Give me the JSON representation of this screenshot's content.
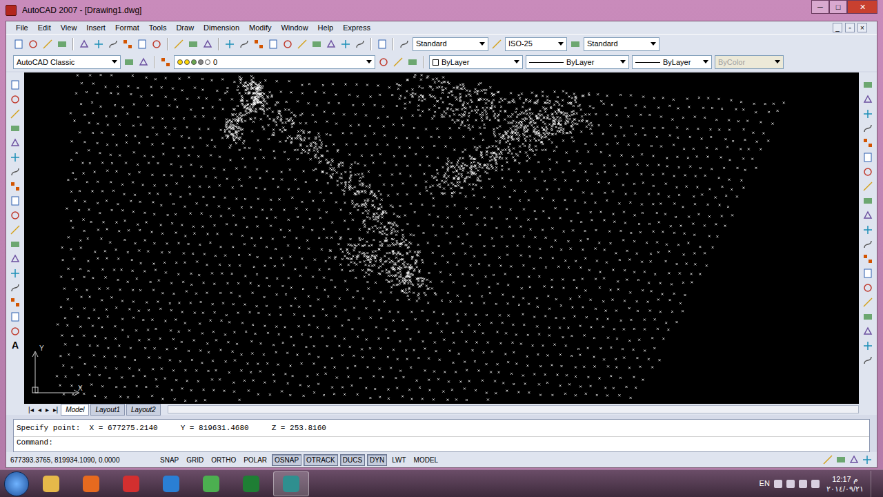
{
  "window": {
    "title": "AutoCAD 2007 - [Drawing1.dwg]",
    "controls": [
      "─",
      "□",
      "✕"
    ],
    "document_controls": [
      "_",
      "▫",
      "×"
    ]
  },
  "menu": [
    "File",
    "Edit",
    "View",
    "Insert",
    "Format",
    "Tools",
    "Draw",
    "Dimension",
    "Modify",
    "Window",
    "Help",
    "Express"
  ],
  "toolbar": {
    "text_style": "Standard",
    "dim_style": "ISO-25",
    "table_style": "Standard",
    "workspace": "AutoCAD Classic",
    "layer": "0",
    "color": "ByLayer",
    "linetype": "ByLayer",
    "lineweight": "ByLayer",
    "plot_style": {
      "label": "ByColor",
      "disabled": true
    }
  },
  "left_palette_text": "A",
  "ucs": {
    "x": "X",
    "y": "Y"
  },
  "tab_nav": [
    "|◂",
    "◂",
    "▸",
    "▸|"
  ],
  "layout_tabs": [
    {
      "label": "Model",
      "selected": true
    },
    {
      "label": "Layout1",
      "selected": false
    },
    {
      "label": "Layout2",
      "selected": false
    }
  ],
  "command_line": {
    "history": "Specify point:  X = 677275.2140     Y = 819631.4680     Z = 253.8160",
    "prompt": "Command:"
  },
  "status_bar": {
    "coordinates": "677393.3765, 819934.1090, 0.0000",
    "toggles": [
      {
        "label": "SNAP",
        "on": false
      },
      {
        "label": "GRID",
        "on": false
      },
      {
        "label": "ORTHO",
        "on": false
      },
      {
        "label": "POLAR",
        "on": false
      },
      {
        "label": "OSNAP",
        "on": true
      },
      {
        "label": "OTRACK",
        "on": true
      },
      {
        "label": "DUCS",
        "on": true
      },
      {
        "label": "DYN",
        "on": true
      },
      {
        "label": "LWT",
        "on": false
      },
      {
        "label": "MODEL",
        "on": false
      }
    ]
  },
  "taskbar": {
    "language": "EN",
    "time": "12:17 م",
    "date": "٢٠١٤/٠٩/٢١"
  }
}
